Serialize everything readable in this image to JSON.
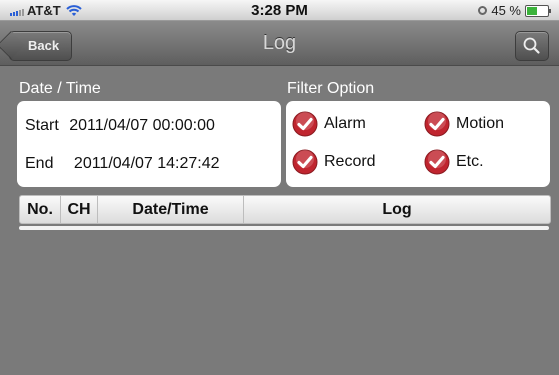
{
  "status_bar": {
    "carrier": "AT&T",
    "time": "3:28 PM",
    "battery": "45 %"
  },
  "nav": {
    "back_label": "Back",
    "title": "Log"
  },
  "date_time": {
    "heading": "Date / Time",
    "start_label": "Start",
    "start_value": "2011/04/07 00:00:00",
    "end_label": "End",
    "end_value": "2011/04/07 14:27:42"
  },
  "filter": {
    "heading": "Filter Option",
    "options": [
      {
        "label": "Alarm",
        "checked": true
      },
      {
        "label": "Motion",
        "checked": true
      },
      {
        "label": "Record",
        "checked": true
      },
      {
        "label": "Etc.",
        "checked": true
      }
    ]
  },
  "table": {
    "columns": [
      "No.",
      "CH",
      "Date/Time",
      "Log"
    ]
  },
  "colors": {
    "check_red": "#c0252f",
    "battery_green": "#3bb33b"
  }
}
